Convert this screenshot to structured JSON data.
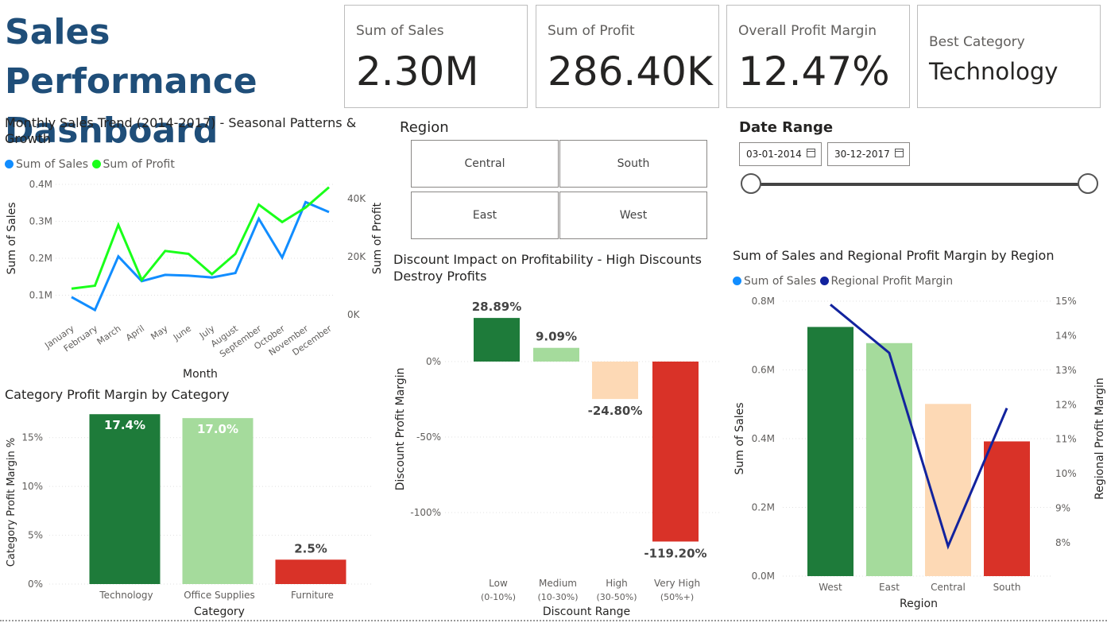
{
  "header": {
    "title": "Sales Performance Dashboard"
  },
  "cards": [
    {
      "label": "Sum of Sales",
      "value": "2.30M"
    },
    {
      "label": "Sum of Profit",
      "value": "286.40K"
    },
    {
      "label": "Overall Profit Margin",
      "value": "12.47%"
    },
    {
      "label": "Best Category",
      "value": "Technology"
    }
  ],
  "region_slicer": {
    "title": "Region",
    "options": [
      "Central",
      "South",
      "East",
      "West"
    ]
  },
  "date_slicer": {
    "title": "Date Range",
    "start": "03-01-2014",
    "end": "30-12-2017"
  },
  "colors": {
    "title": "#1F4E79",
    "sales": "#118DFF",
    "profit": "#1AFF1A",
    "dark_green": "#1E7B3A",
    "light_green": "#A5DB9C",
    "peach": "#FDD9B5",
    "red": "#D93228",
    "navy": "#12239E"
  },
  "chart_data": [
    {
      "id": "monthly",
      "type": "line",
      "title": "Monthly Sales Trend (2014-2017) - Seasonal Patterns & Growth",
      "xlabel": "Month",
      "ylabel": "Sum of Sales",
      "y2label": "Sum of Profit",
      "categories": [
        "January",
        "February",
        "March",
        "April",
        "May",
        "June",
        "July",
        "August",
        "September",
        "October",
        "November",
        "December"
      ],
      "series": [
        {
          "name": "Sum of Sales",
          "axis": "left",
          "values": [
            95000,
            60000,
            205000,
            138000,
            155000,
            153000,
            148000,
            160000,
            307000,
            202000,
            352000,
            325000
          ]
        },
        {
          "name": "Sum of Profit",
          "axis": "right",
          "values": [
            9000,
            10000,
            31000,
            12000,
            22000,
            21000,
            14000,
            21000,
            38000,
            32000,
            37000,
            44000
          ]
        }
      ],
      "yticks": [
        "0.1M",
        "0.2M",
        "0.3M",
        "0.4M"
      ],
      "y2ticks": [
        "0K",
        "20K",
        "40K"
      ],
      "ylim": [
        0,
        400000
      ],
      "y2lim": [
        0,
        45000
      ]
    },
    {
      "id": "category",
      "type": "bar",
      "title": "Category Profit Margin by Category",
      "xlabel": "Category",
      "ylabel": "Category Profit Margin %",
      "categories": [
        "Technology",
        "Office Supplies",
        "Furniture"
      ],
      "values": [
        17.4,
        17.0,
        2.5
      ],
      "labels": [
        "17.4%",
        "17.0%",
        "2.5%"
      ],
      "yticks": [
        "0%",
        "5%",
        "10%",
        "15%"
      ],
      "ylim": [
        0,
        17.5
      ]
    },
    {
      "id": "discount",
      "type": "bar",
      "title": "Discount Impact on Profitability - High Discounts Destroy Profits",
      "xlabel": "Discount Range",
      "ylabel": "Discount Profit Margin",
      "categories": [
        "Low",
        "Medium",
        "High",
        "Very High"
      ],
      "subcategories": [
        "(0-10%)",
        "(10-30%)",
        "(30-50%)",
        "(50%+)"
      ],
      "values": [
        28.89,
        9.09,
        -24.8,
        -119.2
      ],
      "labels": [
        "28.89%",
        "9.09%",
        "-24.80%",
        "-119.20%"
      ],
      "yticks": [
        "0%",
        "-50%",
        "-100%"
      ],
      "ylim": [
        -125,
        35
      ]
    },
    {
      "id": "region",
      "type": "bar",
      "title": "Sum of Sales and Regional Profit Margin by Region",
      "xlabel": "Region",
      "ylabel": "Sum of Sales",
      "y2label": "Regional Profit Margin",
      "categories": [
        "West",
        "East",
        "Central",
        "South"
      ],
      "series": [
        {
          "name": "Sum of Sales",
          "axis": "left",
          "values": [
            725000,
            678000,
            501000,
            392000
          ]
        },
        {
          "name": "Regional Profit Margin",
          "axis": "right",
          "values": [
            14.9,
            13.5,
            7.9,
            11.9
          ]
        }
      ],
      "yticks": [
        "0.0M",
        "0.2M",
        "0.4M",
        "0.6M",
        "0.8M"
      ],
      "y2ticks": [
        "8%",
        "9%",
        "10%",
        "11%",
        "12%",
        "13%",
        "14%",
        "15%"
      ],
      "ylim": [
        0,
        800000
      ],
      "y2lim": [
        7.5,
        15
      ]
    }
  ]
}
